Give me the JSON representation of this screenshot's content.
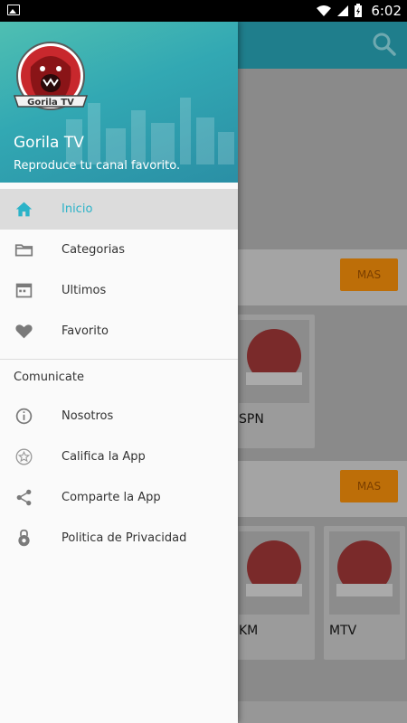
{
  "status_bar": {
    "time": "6:02"
  },
  "background": {
    "mas_label": "MAS",
    "cards": [
      {
        "name": "SPN"
      },
      {
        "name": "KM"
      },
      {
        "name": "MTV"
      }
    ],
    "logo_text": "Gorila TV"
  },
  "drawer": {
    "title": "Gorila TV",
    "subtitle": "Reproduce tu canal favorito.",
    "logo_text": "Gorila TV",
    "menu": [
      {
        "label": "Inicio",
        "icon": "home-icon",
        "active": true
      },
      {
        "label": "Categorias",
        "icon": "folder-icon",
        "active": false
      },
      {
        "label": "Ultimos",
        "icon": "calendar-icon",
        "active": false
      },
      {
        "label": "Favorito",
        "icon": "heart-icon",
        "active": false
      }
    ],
    "section": "Comunicate",
    "menu2": [
      {
        "label": "Nosotros",
        "icon": "info-icon"
      },
      {
        "label": "Califica la App",
        "icon": "star-icon"
      },
      {
        "label": "Comparte la App",
        "icon": "share-icon"
      },
      {
        "label": "Politica de Privacidad",
        "icon": "lock-gear-icon"
      }
    ]
  },
  "colors": {
    "accent": "#2bb3c8",
    "header_teal": "#32a8b3",
    "toolbar": "#1f7e8c",
    "mas_button": "#bd6e08"
  }
}
